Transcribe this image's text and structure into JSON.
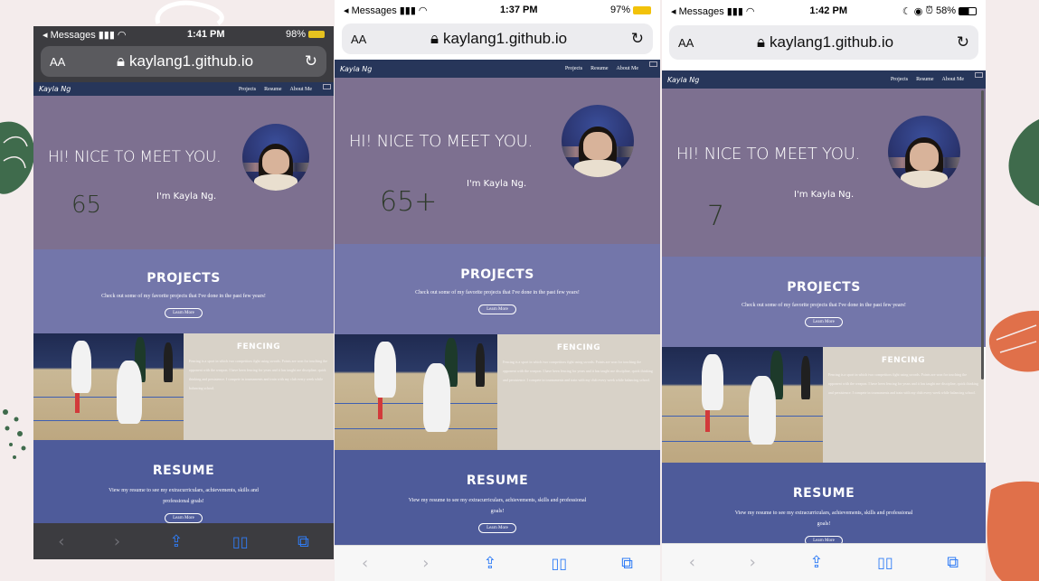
{
  "phones": [
    {
      "status": {
        "back": "◂ Messages",
        "time": "1:41 PM",
        "battery": "98%"
      },
      "address": {
        "aa": "AA",
        "url": "kaylang1.github.io"
      },
      "handwriting": "65",
      "theme": "dark"
    },
    {
      "status": {
        "back": "◂ Messages",
        "time": "1:37 PM",
        "battery": "97%"
      },
      "address": {
        "aa": "AA",
        "url": "kaylang1.github.io"
      },
      "handwriting": "65+",
      "theme": "light"
    },
    {
      "status": {
        "back": "◂ Messages",
        "time": "1:42 PM",
        "battery": "58%"
      },
      "address": {
        "aa": "AA",
        "url": "kaylang1.github.io"
      },
      "handwriting": "7",
      "theme": "light"
    }
  ],
  "site": {
    "logo": "Kayla Ng",
    "nav": [
      "Projects",
      "Resume",
      "About Me"
    ],
    "hero_title": "HI! NICE TO MEET YOU.",
    "hero_sub": "I'm Kayla Ng.",
    "projects_title": "PROJECTS",
    "projects_text": "Check out some of my favorite projects that I've done in the past few years!",
    "learn_more": "Learn More",
    "fencing_title": "FENCING",
    "fencing_text": "Fencing is a sport in which two competitors fight using swords. Points are won for touching the opponent with the weapon. I have been fencing for years and it has taught me discipline, quick thinking and persistence. I compete in tournaments and train with my club every week while balancing school.",
    "resume_title": "RESUME",
    "resume_text": "View my resume to see my extracurriculars, achievements, skills and professional goals!"
  },
  "toolbar": {
    "back": "‹",
    "forward": "›",
    "share": "⇪",
    "bookmarks": "📖",
    "tabs": "⧉"
  },
  "colors": {
    "page_bg": "#f4ecec",
    "nav": "#27365a",
    "hero": "#7d7090",
    "projects": "#7376aa",
    "fencing_panel": "#d8d2c8",
    "resume": "#4e5b9a",
    "blob_green": "#3f6b4c",
    "blob_orange": "#e0704a"
  }
}
